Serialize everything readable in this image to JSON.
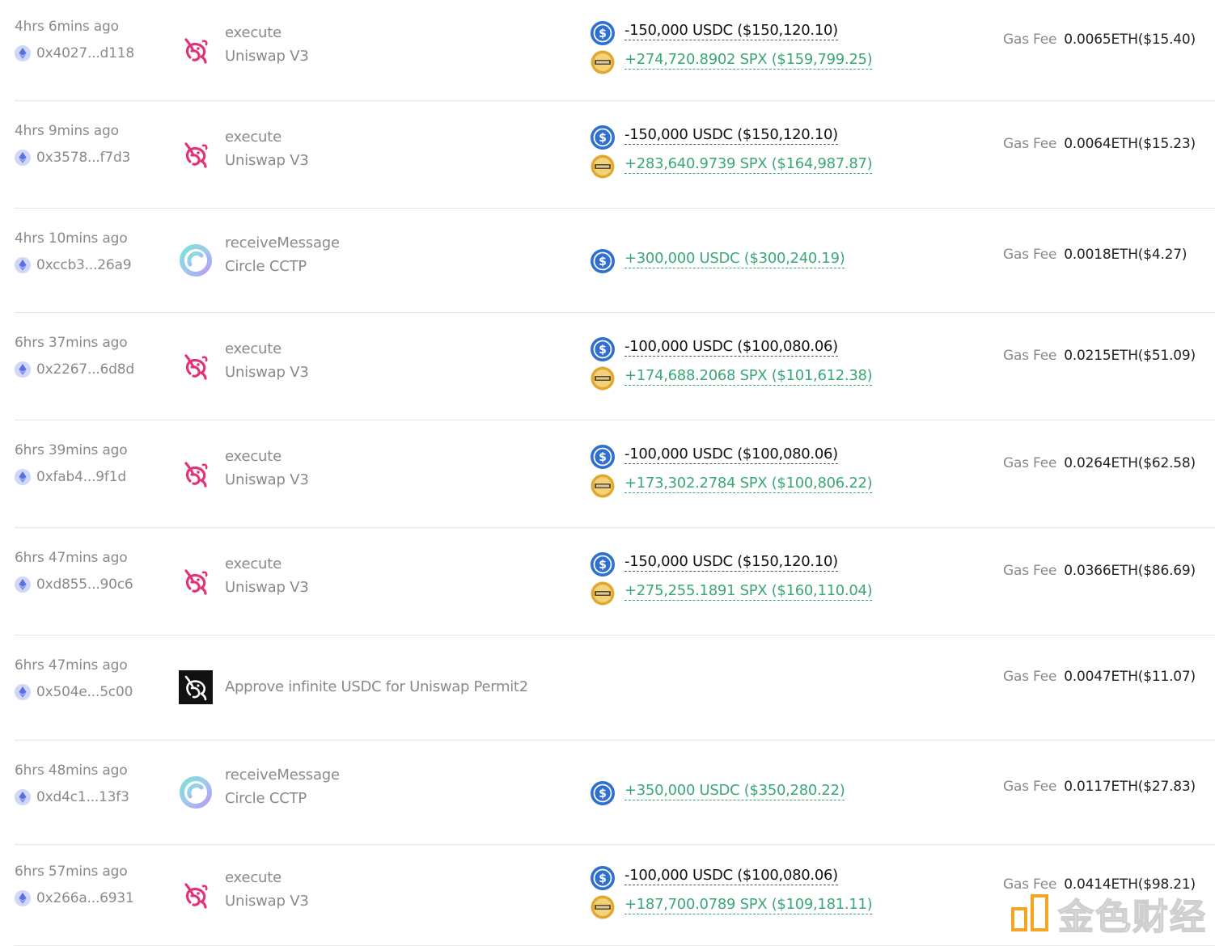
{
  "rows": [
    {
      "time": "4hrs 6mins ago",
      "hash": "0x4027...d118",
      "icon": "uniswap",
      "method": "execute",
      "protocol": "Uniswap V3",
      "tokens": [
        {
          "icon": "usdc",
          "text": "-150,000 USDC ($150,120.10)",
          "dir": "neg"
        },
        {
          "icon": "spx",
          "text": "+274,720.8902 SPX ($159,799.25)",
          "dir": "pos"
        }
      ],
      "fee_label": "Gas Fee",
      "fee": "0.0065ETH($15.40)"
    },
    {
      "time": "4hrs 9mins ago",
      "hash": "0x3578...f7d3",
      "icon": "uniswap",
      "method": "execute",
      "protocol": "Uniswap V3",
      "tokens": [
        {
          "icon": "usdc",
          "text": "-150,000 USDC ($150,120.10)",
          "dir": "neg"
        },
        {
          "icon": "spx",
          "text": "+283,640.9739 SPX ($164,987.87)",
          "dir": "pos"
        }
      ],
      "fee_label": "Gas Fee",
      "fee": "0.0064ETH($15.23)"
    },
    {
      "time": "4hrs 10mins ago",
      "hash": "0xccb3...26a9",
      "icon": "circle",
      "method": "receiveMessage",
      "protocol": "Circle CCTP",
      "tokens": [
        {
          "icon": "usdc",
          "text": "+300,000 USDC ($300,240.19)",
          "dir": "pos"
        }
      ],
      "fee_label": "Gas Fee",
      "fee": "0.0018ETH($4.27)"
    },
    {
      "time": "6hrs 37mins ago",
      "hash": "0x2267...6d8d",
      "icon": "uniswap",
      "method": "execute",
      "protocol": "Uniswap V3",
      "tokens": [
        {
          "icon": "usdc",
          "text": "-100,000 USDC ($100,080.06)",
          "dir": "neg"
        },
        {
          "icon": "spx",
          "text": "+174,688.2068 SPX ($101,612.38)",
          "dir": "pos"
        }
      ],
      "fee_label": "Gas Fee",
      "fee": "0.0215ETH($51.09)"
    },
    {
      "time": "6hrs 39mins ago",
      "hash": "0xfab4...9f1d",
      "icon": "uniswap",
      "method": "execute",
      "protocol": "Uniswap V3",
      "tokens": [
        {
          "icon": "usdc",
          "text": "-100,000 USDC ($100,080.06)",
          "dir": "neg"
        },
        {
          "icon": "spx",
          "text": "+173,302.2784 SPX ($100,806.22)",
          "dir": "pos"
        }
      ],
      "fee_label": "Gas Fee",
      "fee": "0.0264ETH($62.58)"
    },
    {
      "time": "6hrs 47mins ago",
      "hash": "0xd855...90c6",
      "icon": "uniswap",
      "method": "execute",
      "protocol": "Uniswap V3",
      "tokens": [
        {
          "icon": "usdc",
          "text": "-150,000 USDC ($150,120.10)",
          "dir": "neg"
        },
        {
          "icon": "spx",
          "text": "+275,255.1891 SPX ($160,110.04)",
          "dir": "pos"
        }
      ],
      "fee_label": "Gas Fee",
      "fee": "0.0366ETH($86.69)"
    },
    {
      "time": "6hrs 47mins ago",
      "hash": "0x504e...5c00",
      "icon": "uniswap-dark",
      "method": "Approve infinite USDC for Uniswap Permit2",
      "protocol": "",
      "tokens": [],
      "fee_label": "Gas Fee",
      "fee": "0.0047ETH($11.07)"
    },
    {
      "time": "6hrs 48mins ago",
      "hash": "0xd4c1...13f3",
      "icon": "circle",
      "method": "receiveMessage",
      "protocol": "Circle CCTP",
      "tokens": [
        {
          "icon": "usdc",
          "text": "+350,000 USDC ($350,280.22)",
          "dir": "pos"
        }
      ],
      "fee_label": "Gas Fee",
      "fee": "0.0117ETH($27.83)"
    },
    {
      "time": "6hrs 57mins ago",
      "hash": "0x266a...6931",
      "icon": "uniswap",
      "method": "execute",
      "protocol": "Uniswap V3",
      "tokens": [
        {
          "icon": "usdc",
          "text": "-100,000 USDC ($100,080.06)",
          "dir": "neg"
        },
        {
          "icon": "spx",
          "text": "+187,700.0789 SPX ($109,181.11)",
          "dir": "pos"
        }
      ],
      "fee_label": "Gas Fee",
      "fee": "0.0414ETH($98.21)"
    }
  ],
  "watermark": {
    "text": "金色财经",
    "color": "#f5a623"
  }
}
